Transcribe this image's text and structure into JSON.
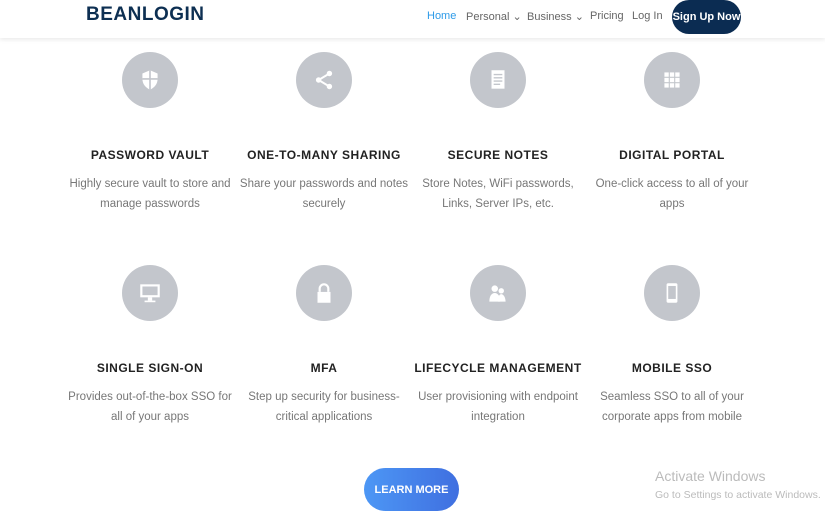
{
  "header": {
    "logo": "BEANLOGIN",
    "nav": [
      {
        "label": "Home"
      },
      {
        "label": "Personal ⌄"
      },
      {
        "label": "Business ⌄"
      },
      {
        "label": "Pricing"
      },
      {
        "label": "Log In"
      }
    ],
    "signup": "Sign Up Now"
  },
  "features": [
    {
      "icon": "shield-icon",
      "title": "PASSWORD VAULT",
      "desc": "Highly secure vault to store and manage passwords"
    },
    {
      "icon": "share-icon",
      "title": "ONE-TO-MANY SHARING",
      "desc": "Share your passwords and notes securely"
    },
    {
      "icon": "notes-icon",
      "title": "SECURE NOTES",
      "desc": "Store Notes, WiFi passwords, Links, Server IPs, etc."
    },
    {
      "icon": "grid-icon",
      "title": "DIGITAL PORTAL",
      "desc": "One-click access to all of your apps"
    },
    {
      "icon": "monitor-icon",
      "title": "SINGLE SIGN-ON",
      "desc": "Provides out-of-the-box SSO for all of your apps"
    },
    {
      "icon": "lock-icon",
      "title": "MFA",
      "desc": "Step up security for business-critical applications"
    },
    {
      "icon": "users-icon",
      "title": "LIFECYCLE MANAGEMENT",
      "desc": "User provisioning with endpoint integration"
    },
    {
      "icon": "mobile-icon",
      "title": "MOBILE SSO",
      "desc": "Seamless SSO to all of your corporate apps from mobile"
    }
  ],
  "learn_more": "LEARN MORE",
  "watermark": {
    "title": "Activate Windows",
    "subtitle": "Go to Settings to activate Windows."
  }
}
